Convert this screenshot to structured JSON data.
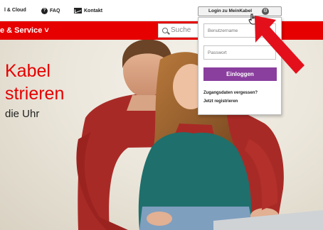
{
  "topbar": {
    "cloud_label": "l & Cloud",
    "faq_label": "FAQ",
    "faq_icon": "question-icon",
    "contact_label": "Kontakt",
    "contact_icon": "mail-icon",
    "login_label": "Login zu MeinKabel",
    "login_icon": "gear-icon"
  },
  "nav": {
    "item_label": "e & Service ˅",
    "search_placeholder": "Suche"
  },
  "hero": {
    "line1": "Kabel",
    "line2": "strieren",
    "line3": "die Uhr"
  },
  "login_panel": {
    "username_placeholder": "Benutzername",
    "password_placeholder": "Passwort",
    "submit_label": "Einloggen",
    "forgot_link": "Zugangsdaten vergessen?",
    "register_link": "Jetzt registrieren"
  },
  "colors": {
    "brand_red": "#e60000",
    "submit_purple": "#8a3f9e",
    "annotation_arrow": "#e3101c"
  }
}
